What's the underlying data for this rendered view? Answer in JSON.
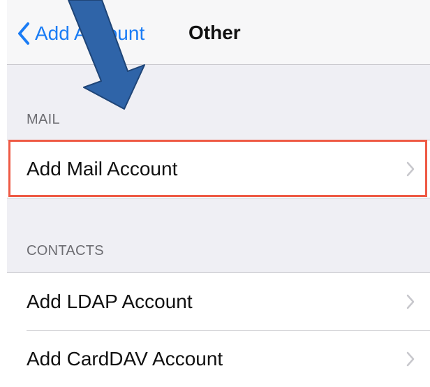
{
  "navbar": {
    "back_label": "Add Account",
    "title": "Other"
  },
  "sections": [
    {
      "header": "MAIL",
      "items": [
        {
          "label": "Add Mail Account",
          "highlighted": true
        }
      ]
    },
    {
      "header": "CONTACTS",
      "items": [
        {
          "label": "Add LDAP Account"
        },
        {
          "label": "Add CardDAV Account"
        }
      ]
    }
  ],
  "icons": {
    "back": "chevron-left-icon",
    "disclosure": "chevron-right-icon",
    "annotation": "arrow-pointer"
  },
  "colors": {
    "ios_blue": "#1a7cf5",
    "highlight_red": "#ee5a45",
    "annotation_arrow": "#2f64a8",
    "background": "#efeff4"
  }
}
